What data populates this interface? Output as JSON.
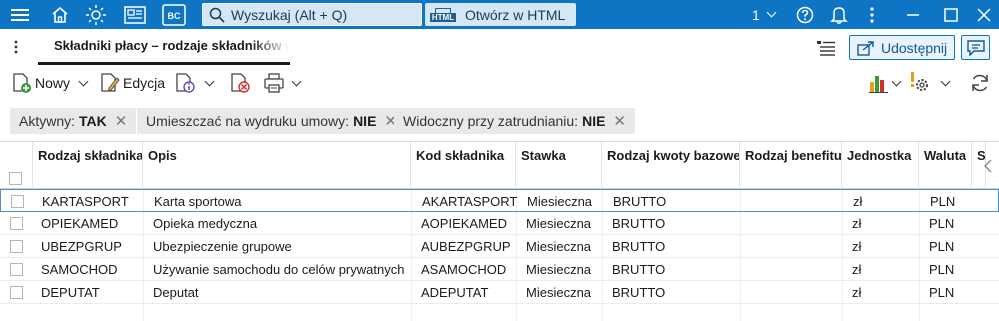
{
  "topbar": {
    "search_placeholder": "Wyszukaj (Alt + Q)",
    "html_badge": "HTML",
    "open_html_label": "Otwórz w HTML",
    "notification_count": "1",
    "logo_text": "BC"
  },
  "tab": {
    "title": "Składniki płacy – rodzaje składników wynagrodzenia"
  },
  "toolbar": {
    "new_label": "Nowy",
    "edit_label": "Edycja",
    "share_label": "Udostępnij"
  },
  "filters": [
    {
      "label": "Aktywny:",
      "value": "TAK"
    },
    {
      "label": "Umieszczać na wydruku umowy:",
      "value": "NIE"
    },
    {
      "label": "Widoczny przy zatrudnianiu:",
      "value": "NIE"
    }
  ],
  "columns": [
    "Rodzaj składnika",
    "Opis",
    "Kod składnika",
    "Stawka",
    "Rodzaj kwoty bazowej",
    "Rodzaj benefitu",
    "Jednostka",
    "Waluta",
    "S"
  ],
  "rows": [
    [
      "KARTASPORT",
      "Karta sportowa",
      "AKARTASPORT",
      "Miesieczna",
      "BRUTTO",
      "",
      "zł",
      "PLN"
    ],
    [
      "OPIEKAMED",
      "Opieka medyczna",
      "AOPIEKAMED",
      "Miesieczna",
      "BRUTTO",
      "",
      "zł",
      "PLN"
    ],
    [
      "UBEZPGRUP",
      "Ubezpieczenie grupowe",
      "AUBEZPGRUP",
      "Miesieczna",
      "BRUTTO",
      "",
      "zł",
      "PLN"
    ],
    [
      "SAMOCHOD",
      "Używanie samochodu do celów prywatnych",
      "ASAMOCHOD",
      "Miesieczna",
      "BRUTTO",
      "",
      "zł",
      "PLN"
    ],
    [
      "DEPUTAT",
      "Deputat",
      "ADEPUTAT",
      "Miesieczna",
      "BRUTTO",
      "",
      "zł",
      "PLN"
    ]
  ],
  "colors": {
    "topbar": "#0e74c4",
    "accent": "#0e74c4",
    "chip_bg": "#e9e9e9"
  }
}
